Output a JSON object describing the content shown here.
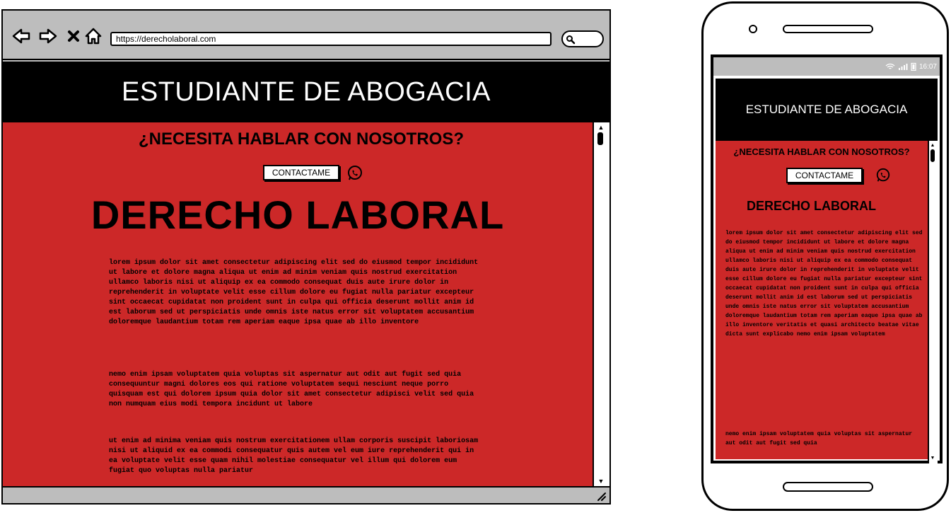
{
  "desktop": {
    "url": "https://derecholaboral.com",
    "header_title": "ESTUDIANTE DE ABOGACIA",
    "question": "¿NECESITA HABLAR CON NOSOTROS?",
    "contact_label": "CONTACTAME",
    "page_title": "DERECHO LABORAL",
    "paragraphs": [
      "lorem ipsum dolor sit amet consectetur adipiscing elit sed do eiusmod tempor incididunt ut labore et dolore magna aliqua ut enim ad minim veniam quis nostrud exercitation ullamco laboris nisi ut aliquip ex ea commodo consequat duis aute irure dolor in reprehenderit in voluptate velit esse cillum dolore eu fugiat nulla pariatur excepteur sint occaecat cupidatat non proident sunt in culpa qui officia deserunt mollit anim id est laborum sed ut perspiciatis unde omnis iste natus error sit voluptatem accusantium doloremque laudantium totam rem aperiam eaque ipsa quae ab illo inventore",
      "nemo enim ipsam voluptatem quia voluptas sit aspernatur aut odit aut fugit sed quia consequuntur magni dolores eos qui ratione voluptatem sequi nesciunt neque porro quisquam est qui dolorem ipsum quia dolor sit amet consectetur adipisci velit sed quia non numquam eius modi tempora incidunt ut labore",
      "ut enim ad minima veniam quis nostrum exercitationem ullam corporis suscipit laboriosam nisi ut aliquid ex ea commodi consequatur quis autem vel eum iure reprehenderit qui in ea voluptate velit esse quam nihil molestiae consequatur vel illum qui dolorem eum fugiat quo voluptas nulla pariatur"
    ]
  },
  "mobile": {
    "time": "16:07",
    "header_title": "ESTUDIANTE DE ABOGACIA",
    "question": "¿NECESITA HABLAR CON NOSOTROS?",
    "contact_label": "CONTACTAME",
    "page_title": "DERECHO LABORAL",
    "paragraphs": [
      "lorem ipsum dolor sit amet consectetur adipiscing elit sed do eiusmod tempor incididunt ut labore et dolore magna aliqua ut enim ad minim veniam quis nostrud exercitation ullamco laboris nisi ut aliquip ex ea commodo consequat duis aute irure dolor in reprehenderit in voluptate velit esse cillum dolore eu fugiat nulla pariatur excepteur sint occaecat cupidatat non proident sunt in culpa qui officia deserunt mollit anim id est laborum sed ut perspiciatis unde omnis iste natus error sit voluptatem accusantium doloremque laudantium totam rem aperiam eaque ipsa quae ab illo inventore veritatis et quasi architecto beatae vitae dicta sunt explicabo nemo enim ipsam voluptatem",
      "nemo enim ipsam voluptatem quia voluptas sit aspernatur aut odit aut fugit sed quia"
    ]
  },
  "colors": {
    "content_bg": "#cc2828",
    "header_bg": "#000000",
    "chrome_bg": "#bdbdbd"
  },
  "icons": [
    "back-arrow-icon",
    "forward-arrow-icon",
    "close-icon",
    "home-icon",
    "search-icon",
    "whatsapp-icon",
    "wifi-icon",
    "signal-icon",
    "battery-icon",
    "resize-grip-icon"
  ]
}
